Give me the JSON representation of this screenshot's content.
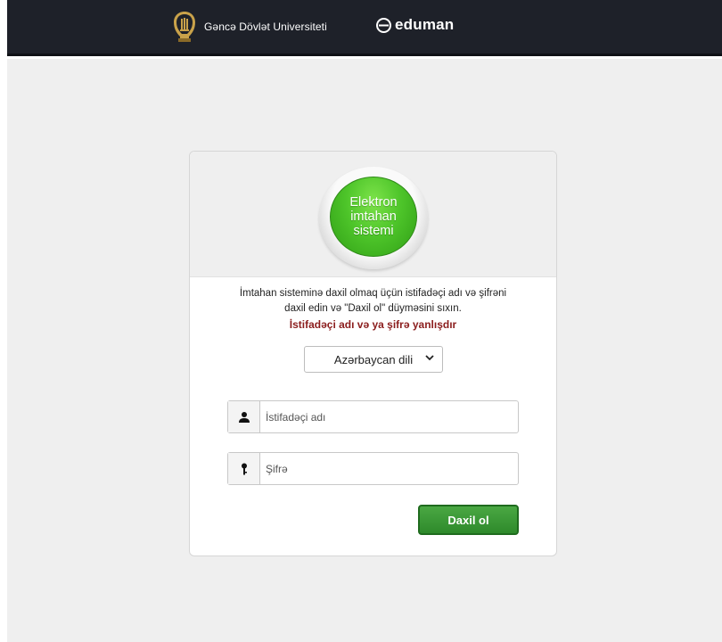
{
  "header": {
    "university_name": "Gəncə Dövlət Universiteti",
    "brand_name": "eduman",
    "university_logo_icon": "university-crest-icon",
    "brand_logo_icon": "eduman-logo-icon"
  },
  "login": {
    "badge_lines": [
      "Elektron",
      "imtahan",
      "sistemi"
    ],
    "instruction_line1": "İmtahan sisteminə daxil olmaq üçün istifadəçi adı və şifrəni",
    "instruction_line2": "daxil edin və \"Daxil ol\" düyməsini sıxın.",
    "error_message": "İstifadəçi adı və ya şifrə yanlışdır",
    "language_selected": "Azərbaycan dili",
    "username_placeholder": "İstifadəçi adı",
    "password_placeholder": "Şifrə",
    "submit_label": "Daxil ol",
    "username_icon": "user-icon",
    "password_icon": "key-icon"
  },
  "colors": {
    "header_bg": "#1e2129",
    "badge_green": "#4ec52a",
    "error_red": "#8b1d1d",
    "button_green": "#2e8a2b"
  }
}
